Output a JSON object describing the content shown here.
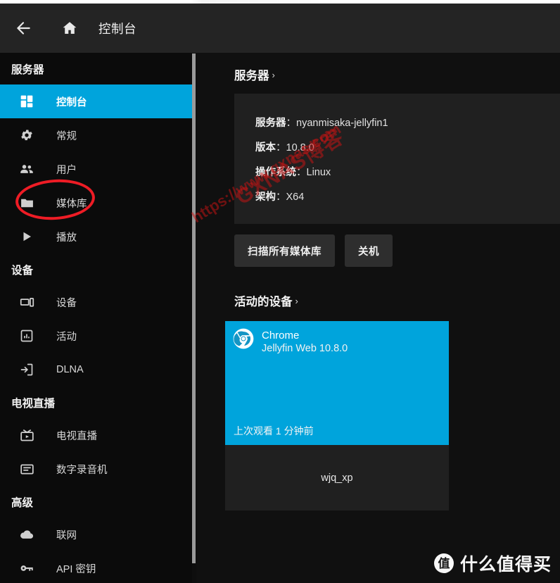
{
  "header": {
    "back_icon": "arrow-left-icon",
    "home_icon": "home-icon",
    "title": "控制台"
  },
  "sidebar": {
    "groups": [
      {
        "title": "服务器",
        "items": [
          {
            "label": "控制台",
            "icon": "dashboard-icon",
            "active": true
          },
          {
            "label": "常规",
            "icon": "gear-icon",
            "active": false
          },
          {
            "label": "用户",
            "icon": "users-icon",
            "active": false
          },
          {
            "label": "媒体库",
            "icon": "folder-icon",
            "active": false
          },
          {
            "label": "播放",
            "icon": "play-icon",
            "active": false
          }
        ]
      },
      {
        "title": "设备",
        "items": [
          {
            "label": "设备",
            "icon": "devices-icon",
            "active": false
          },
          {
            "label": "活动",
            "icon": "activity-icon",
            "active": false
          },
          {
            "label": "DLNA",
            "icon": "dlna-icon",
            "active": false
          }
        ]
      },
      {
        "title": "电视直播",
        "items": [
          {
            "label": "电视直播",
            "icon": "live-tv-icon",
            "active": false
          },
          {
            "label": "数字录音机",
            "icon": "dvr-icon",
            "active": false
          }
        ]
      },
      {
        "title": "高级",
        "items": [
          {
            "label": "联网",
            "icon": "cloud-icon",
            "active": false
          },
          {
            "label": "API 密钥",
            "icon": "key-icon",
            "active": false
          }
        ]
      }
    ]
  },
  "main": {
    "server_section": {
      "heading": "服务器",
      "chevron": "›",
      "rows": [
        {
          "label": "服务器",
          "sep": "：",
          "value": "nyanmisaka-jellyfin1"
        },
        {
          "label": "版本",
          "sep": "：",
          "value": "10.8.0"
        },
        {
          "label": "操作系统",
          "sep": "：",
          "value": "Linux"
        },
        {
          "label": "架构",
          "sep": "：",
          "value": "X64"
        }
      ]
    },
    "buttons": {
      "scan_all": "扫描所有媒体库",
      "shutdown": "关机"
    },
    "devices_section": {
      "heading": "活动的设备",
      "chevron": "›",
      "cards": [
        {
          "app": "Chrome",
          "client": "Jellyfin Web 10.8.0",
          "last_seen": "上次观看 1 分钟前",
          "user": "wjq_xp",
          "icon": "chrome-icon",
          "accent": "#00a4dc"
        }
      ]
    }
  },
  "annotations": {
    "ellipse_target": "媒体库",
    "ellipse_color": "#ee1c25"
  },
  "watermarks": {
    "diagonal_line1": "GXNAS博客",
    "diagonal_line2": "https://www.gxnas.com",
    "brand_badge": "值",
    "brand_text": "什么值得买"
  },
  "theme": {
    "accent": "#00a4dc",
    "page_bg": "#101010",
    "sidebar_bg": "#0b0b0b",
    "header_bg": "#242424",
    "card_bg": "#202020"
  }
}
